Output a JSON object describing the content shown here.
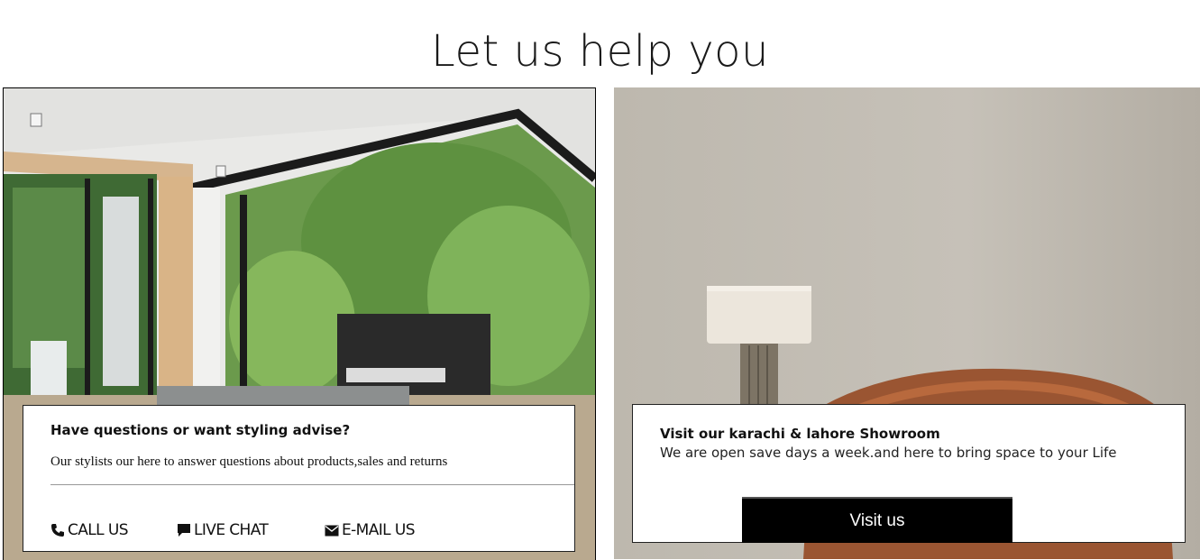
{
  "page": {
    "heading": "Let us help you"
  },
  "help_card": {
    "title": "Have questions or want styling advise?",
    "description": "Our stylists our here to answer questions about products,sales and returns",
    "actions": [
      {
        "label": "CALL US",
        "icon": "phone-icon"
      },
      {
        "label": "LIVE CHAT",
        "icon": "chat-bubble-icon"
      },
      {
        "label": "E-MAIL US",
        "icon": "envelope-icon"
      }
    ]
  },
  "showroom_card": {
    "title": "Visit our karachi & lahore Showroom",
    "description": "We are open save days a week.and here to bring space to your Life",
    "button_label": "Visit us"
  },
  "colors": {
    "button_bg": "#000000",
    "text": "#111111",
    "wall": "#c2bdb3",
    "chair": "#9a5532"
  }
}
